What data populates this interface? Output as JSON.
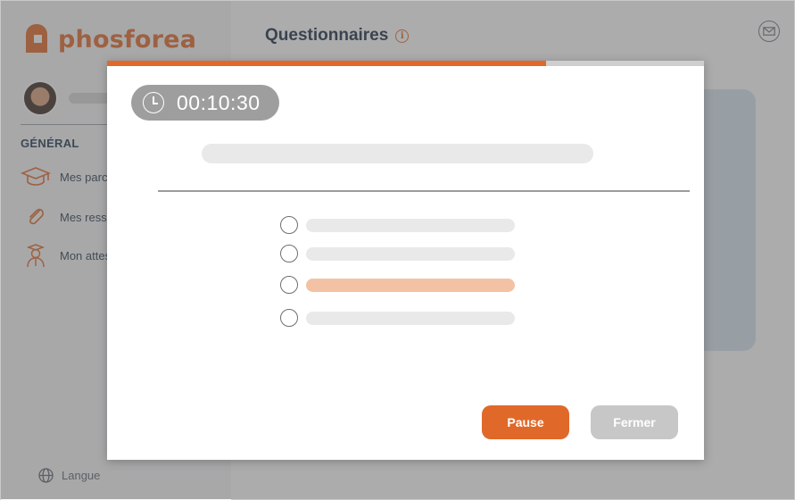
{
  "app": {
    "brand": "phosforea",
    "brand_color": "#e0692a",
    "page_title": "Questionnaires",
    "info_icon_glyph": "i"
  },
  "sidebar": {
    "section_title": "GÉNÉRAL",
    "items": [
      {
        "label": "Mes parco",
        "icon": "graduation-cap-icon"
      },
      {
        "label": "Mes resso",
        "icon": "paperclip-icon"
      },
      {
        "label": "Mon attes",
        "icon": "graduate-person-icon"
      }
    ],
    "language_label": "Langue"
  },
  "quiz": {
    "timer": "00:10:30",
    "progress": 0.736,
    "options_count": 4,
    "selected_option": 3,
    "pause_label": "Pause",
    "close_label": "Fermer"
  }
}
